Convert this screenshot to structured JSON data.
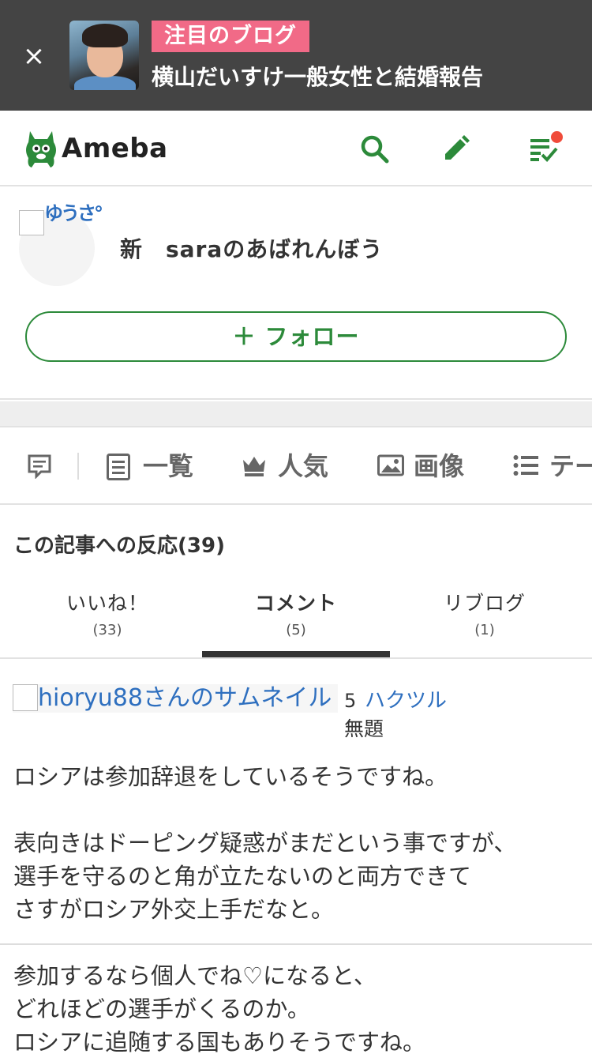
{
  "banner": {
    "close_glyph": "×",
    "tag": "注目のブログ",
    "headline": "横山だいすけ一般女性と結婚報告"
  },
  "header": {
    "logo_text": "Ameba",
    "icons": [
      "search-icon",
      "pencil-icon",
      "checklist-icon"
    ],
    "accent_color": "#2c8a3a",
    "notification_color": "#f04b3a"
  },
  "profile": {
    "avatar_alt": "ゆうさ°",
    "blog_name": "新　saraのあばれんぼう",
    "follow_label": "＋ フォロー"
  },
  "nav": {
    "items": [
      {
        "icon": "comment-icon",
        "label": ""
      },
      {
        "icon": "list-icon",
        "label": "一覧"
      },
      {
        "icon": "crown-icon",
        "label": "人気"
      },
      {
        "icon": "image-icon",
        "label": "画像"
      },
      {
        "icon": "bullets-icon",
        "label": "テー"
      }
    ]
  },
  "reactions": {
    "title": "この記事への反応(39)",
    "tabs": [
      {
        "label": "いいね！",
        "count": "(33)"
      },
      {
        "label": "コメント",
        "count": "(5)",
        "active": true
      },
      {
        "label": "リブログ",
        "count": "(1)"
      }
    ]
  },
  "comment": {
    "thumb_alt": "hioryu88さんのサムネイル",
    "number": "5",
    "user": "ハクツル",
    "title": "無題",
    "body": [
      "ロシアは参加辞退をしているそうですね。",
      "",
      "表向きはドーピング疑惑がまだという事ですが、",
      "選手を守るのと角が立たないのと両方できて",
      "さすがロシア外交上手だなと。"
    ]
  },
  "comment2": {
    "body": [
      "参加するなら個人でね♡になると、",
      "どれほどの選手がくるのか。",
      "ロシアに追随する国もありそうですね。"
    ]
  }
}
